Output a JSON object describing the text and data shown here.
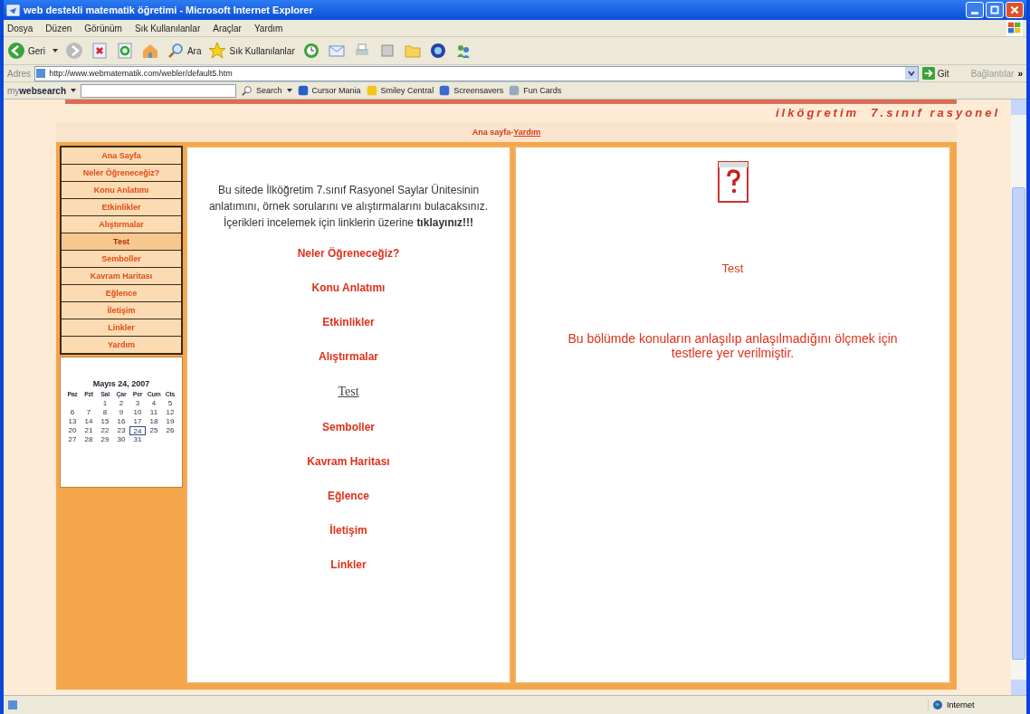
{
  "window": {
    "title": "web destekli matematik öğretimi - Microsoft Internet Explorer"
  },
  "menu": [
    "Dosya",
    "Düzen",
    "Görünüm",
    "Sık Kullanılanlar",
    "Araçlar",
    "Yardım"
  ],
  "toolbar": {
    "back": "Geri",
    "search": "Ara",
    "favorites": "Sık Kullanılanlar"
  },
  "address": {
    "label": "Adres",
    "value": "http://www.webmatematik.com/webler/default5.htm",
    "go": "Git",
    "links": "Bağlantılar",
    "more": "»"
  },
  "search_bar": {
    "brand_prefix": "my",
    "brand": "websearch",
    "search": "Search",
    "links": [
      "Cursor Mania",
      "Smiley Central",
      "Screensavers",
      "Fun Cards"
    ]
  },
  "page": {
    "banner": "ilkögretim  7.sınıf rasyonel",
    "crumb": "Ana sayfa-",
    "crumb_link": "Yardım",
    "sidebar": [
      {
        "label": "Ana Sayfa",
        "selected": false
      },
      {
        "label": "Neler Öğreneceğiz?",
        "selected": false
      },
      {
        "label": "Konu Anlatımı",
        "selected": false
      },
      {
        "label": "Etkinlikler",
        "selected": false
      },
      {
        "label": "Alıştırmalar",
        "selected": false
      },
      {
        "label": "Test",
        "selected": true
      },
      {
        "label": "Semboller",
        "selected": false
      },
      {
        "label": "Kavram Haritası",
        "selected": false
      },
      {
        "label": "Eğlence",
        "selected": false
      },
      {
        "label": "İletişim",
        "selected": false
      },
      {
        "label": "Linkler",
        "selected": false
      },
      {
        "label": "Yardım",
        "selected": false
      }
    ],
    "calendar": {
      "title": "Mayıs 24, 2007",
      "days": [
        "Paz",
        "Pzt",
        "Sal",
        "Çar",
        "Per",
        "Cum",
        "Cts"
      ],
      "weeks": [
        [
          {
            "day": "1",
            "today": false
          },
          {
            "day": "2",
            "today": false
          },
          {
            "day": "3",
            "today": false
          },
          {
            "day": "4",
            "today": false
          },
          {
            "day": "5",
            "today": false
          }
        ],
        [
          {
            "day": "6",
            "today": false
          },
          {
            "day": "7",
            "today": false
          },
          {
            "day": "8",
            "today": false
          },
          {
            "day": "9",
            "today": false
          },
          {
            "day": "10",
            "today": false
          },
          {
            "day": "11",
            "today": false
          },
          {
            "day": "12",
            "today": false
          }
        ],
        [
          {
            "day": "13",
            "today": false
          },
          {
            "day": "14",
            "today": false
          },
          {
            "day": "15",
            "today": false
          },
          {
            "day": "16",
            "today": false
          },
          {
            "day": "17",
            "today": false
          },
          {
            "day": "18",
            "today": false
          },
          {
            "day": "19",
            "today": false
          }
        ],
        [
          {
            "day": "20",
            "today": false
          },
          {
            "day": "21",
            "today": false
          },
          {
            "day": "22",
            "today": false
          },
          {
            "day": "23",
            "today": false
          },
          {
            "day": "24",
            "today": true
          },
          {
            "day": "25",
            "today": false
          },
          {
            "day": "26",
            "today": false
          }
        ],
        [
          {
            "day": "27",
            "today": false
          },
          {
            "day": "28",
            "today": false
          },
          {
            "day": "29",
            "today": false
          },
          {
            "day": "30",
            "today": false
          },
          {
            "day": "31",
            "today": false
          }
        ]
      ]
    },
    "intro": "Bu sitede İlköğretim 7.sınıf Rasyonel Saylar Ünitesinin anlatımını, örnek  sorularını ve alıştırmalarını bulacaksınız. İçerikleri incelemek için linklerin üzerine  **tıklayınız!!!**",
    "links": [
      {
        "label": "Neler Öğreneceğiz?",
        "visited": false
      },
      {
        "label": "Konu Anlatımı",
        "visited": false
      },
      {
        "label": "Etkinlikler",
        "visited": false
      },
      {
        "label": "Alıştırmalar",
        "visited": false
      },
      {
        "label": "Test",
        "visited": true
      },
      {
        "label": "Semboller",
        "visited": false
      },
      {
        "label": "Kavram Haritası",
        "visited": false
      },
      {
        "label": "Eğlence",
        "visited": false
      },
      {
        "label": "İletişim",
        "visited": false
      },
      {
        "label": "Linkler",
        "visited": false
      }
    ],
    "detail": {
      "title": "Test",
      "text": "Bu bölümde konuların anlaşılıp anlaşılmadığını ölçmek için testlere yer verilmiştir."
    }
  },
  "status_bar": {
    "zone": "Internet"
  }
}
